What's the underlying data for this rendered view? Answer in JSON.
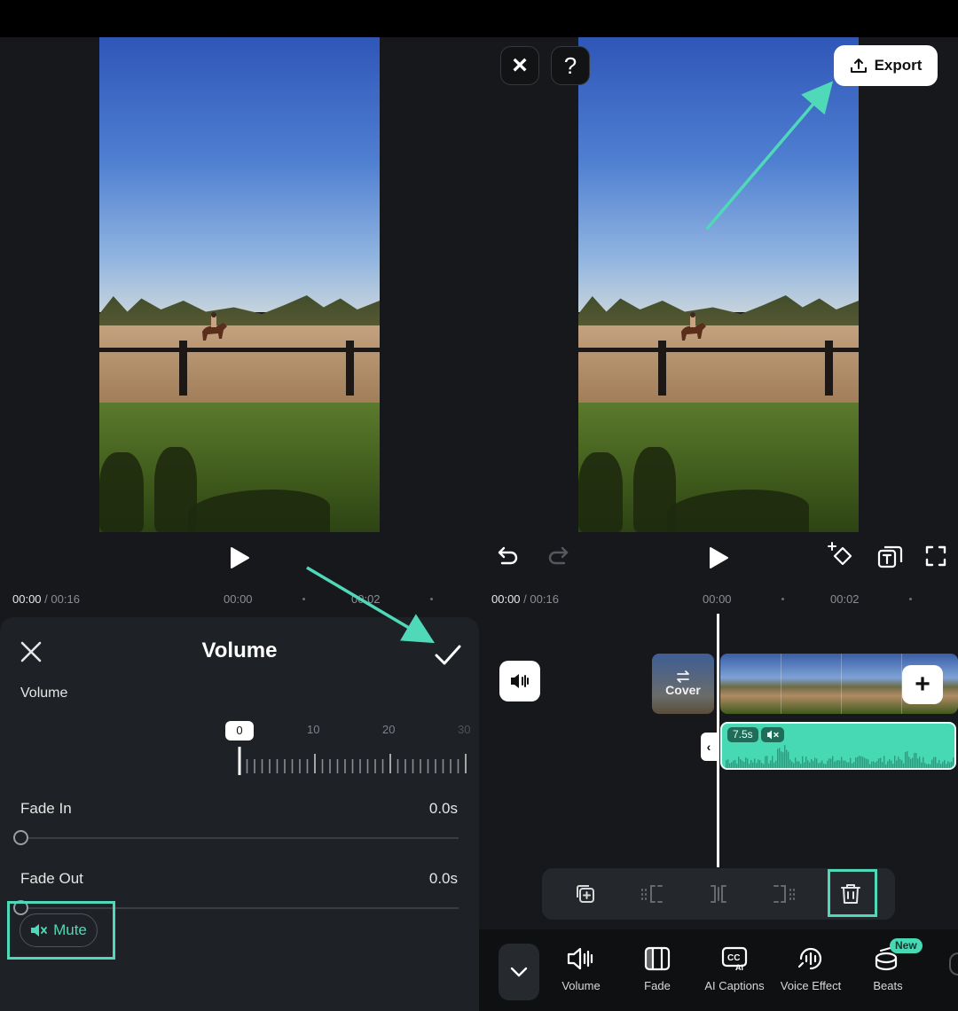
{
  "left": {
    "time": {
      "current": "00:00",
      "total": "00:16",
      "marks": [
        "00:00",
        "00:02"
      ]
    },
    "sheet": {
      "title": "Volume",
      "volume_label": "Volume",
      "volume_value": "0",
      "scale": [
        "10",
        "20",
        "30"
      ],
      "fade_in_label": "Fade In",
      "fade_in_value": "0.0s",
      "fade_out_label": "Fade Out",
      "fade_out_value": "0.0s",
      "mute_label": "Mute"
    }
  },
  "right": {
    "top": {
      "close_label": "×",
      "help_label": "?",
      "export_label": "Export"
    },
    "time": {
      "current": "00:00",
      "total": "00:16",
      "marks": [
        "00:00",
        "00:02"
      ]
    },
    "timeline": {
      "cover_label": "Cover",
      "audio_duration": "7.5s"
    },
    "tools": [
      {
        "label": "Volume",
        "icon": "volume-icon"
      },
      {
        "label": "Fade",
        "icon": "fade-icon"
      },
      {
        "label": "AI Captions",
        "icon": "ai-captions-icon"
      },
      {
        "label": "Voice Effect",
        "icon": "voice-effect-icon"
      },
      {
        "label": "Beats",
        "icon": "beats-icon",
        "badge": "New"
      }
    ]
  },
  "colors": {
    "accent": "#4fd9b8",
    "panel": "#16181c",
    "sheet": "#1e2125"
  }
}
